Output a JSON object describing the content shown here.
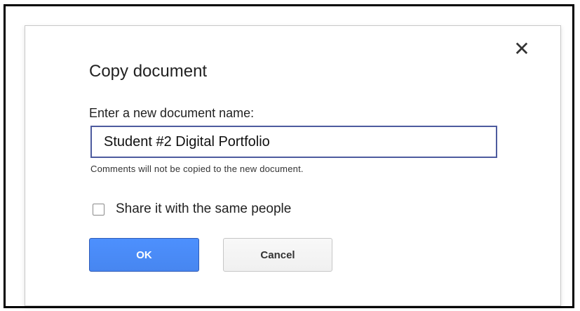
{
  "dialog": {
    "title": "Copy document",
    "close_icon": "close-icon",
    "field_label": "Enter a new document name:",
    "document_name_value": "Student #2 Digital Portfolio",
    "note": "Comments will not be copied to the new document.",
    "share_checkbox": {
      "label": "Share it with the same people",
      "checked": false
    },
    "buttons": {
      "ok_label": "OK",
      "cancel_label": "Cancel"
    }
  },
  "colors": {
    "ok_button": "#4a8af4",
    "input_border": "#4d5b9e",
    "frame_border": "#000000"
  }
}
